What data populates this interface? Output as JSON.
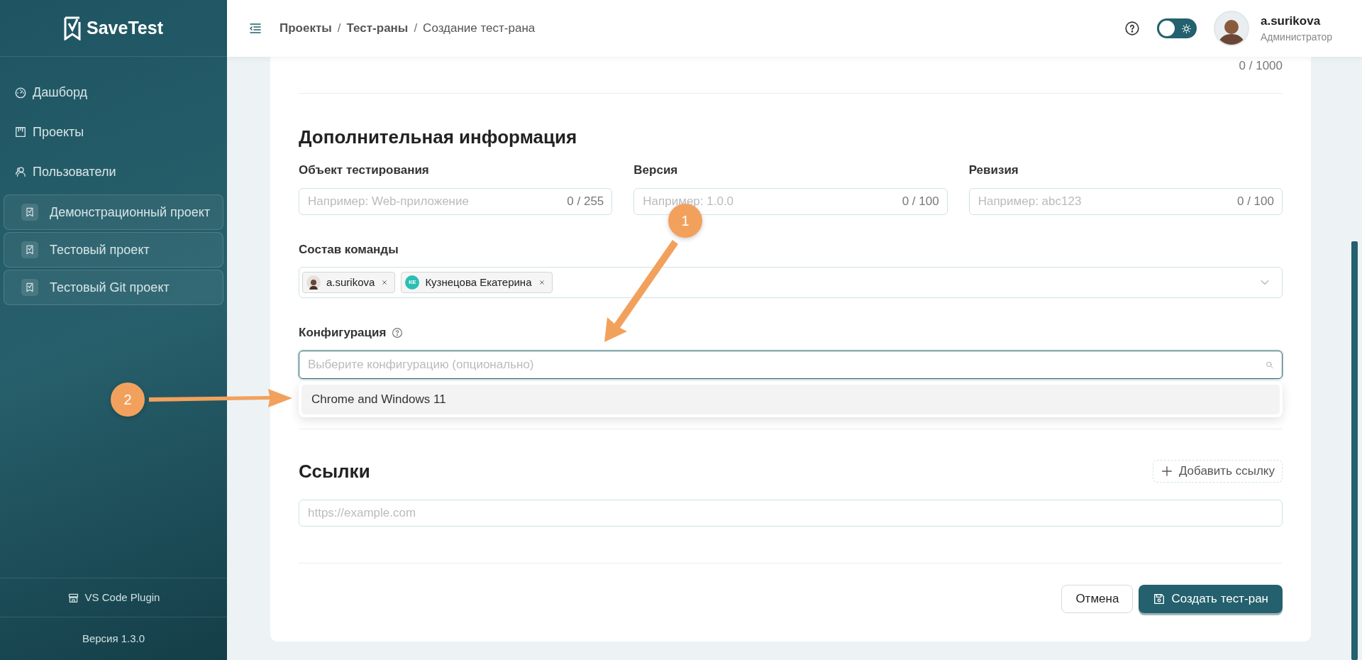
{
  "sidebar": {
    "logo": "SaveTest",
    "nav": [
      {
        "label": "Дашборд"
      },
      {
        "label": "Проекты"
      },
      {
        "label": "Пользователи"
      }
    ],
    "projects": [
      {
        "label": "Демонстрационный проект"
      },
      {
        "label": "Тестовый проект"
      },
      {
        "label": "Тестовый Git проект"
      }
    ],
    "plugin": "VS Code Plugin",
    "version": "Версия 1.3.0"
  },
  "header": {
    "breadcrumbs": [
      {
        "label": "Проекты",
        "current": false
      },
      {
        "label": "Тест-раны",
        "current": false
      },
      {
        "label": "Создание тест-рана",
        "current": true
      }
    ],
    "separator": "/",
    "theme_toggle": {
      "on": false
    },
    "user": {
      "name": "a.surikova",
      "role": "Администратор"
    }
  },
  "form": {
    "description_counter": "0 / 1000",
    "section_title": "Дополнительная информация",
    "fields": [
      {
        "label": "Объект тестирования",
        "placeholder": "Например: Web-приложение",
        "counter": "0 / 255"
      },
      {
        "label": "Версия",
        "placeholder": "Например: 1.0.0",
        "counter": "0 / 100"
      },
      {
        "label": "Ревизия",
        "placeholder": "Например: abc123",
        "counter": "0 / 100"
      }
    ],
    "team": {
      "label": "Состав команды",
      "members": [
        {
          "name": "a.surikova",
          "kind": "photo"
        },
        {
          "name": "Кузнецова Екатерина",
          "kind": "initials",
          "initials": "КЕ",
          "color": "#2bbfb3"
        }
      ]
    },
    "configuration": {
      "label": "Конфигурация",
      "placeholder": "Выберите конфигурацию (опционально)",
      "focused": true,
      "options": [
        {
          "label": "Chrome and Windows 11",
          "highlighted": true
        }
      ]
    },
    "links": {
      "title": "Ссылки",
      "add_button": "Добавить ссылку",
      "placeholder": "https://example.com"
    },
    "buttons": [
      {
        "label": "Отмена",
        "kind": "secondary"
      },
      {
        "label": "Создать тест-ран",
        "kind": "primary"
      }
    ]
  },
  "annotations": [
    {
      "number": "1"
    },
    {
      "number": "2"
    }
  ]
}
